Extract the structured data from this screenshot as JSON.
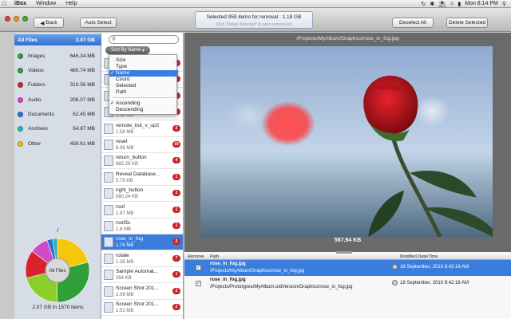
{
  "menubar": {
    "app_name": "iBox",
    "menus": [
      "Window",
      "Help"
    ],
    "clock": "Mon 8:14 PM",
    "icons": [
      "apple-icon",
      "sync-icon",
      "bluetooth-icon",
      "wifi-icon",
      "volume-icon",
      "battery-icon",
      "spotlight-icon"
    ]
  },
  "toolbar": {
    "back_label": "Back",
    "auto_select_label": "Auto Select",
    "status_line1": "Selected 959 items for removal : 1.18 GB",
    "status_line2": "Click \"Delete Selected\" to open remove list",
    "deselect_all_label": "Deselect All",
    "delete_selected_label": "Delete Selected"
  },
  "sidebar": {
    "categories": [
      {
        "name": "All Files",
        "size": "2.07 GB",
        "color": "#3b7ddd"
      },
      {
        "name": "Images",
        "size": "646.34 MB",
        "color": "#2f9f3a"
      },
      {
        "name": "Videos",
        "size": "460.74 MB",
        "color": "#2f9f3a"
      },
      {
        "name": "Folders",
        "size": "310.56 MB",
        "color": "#d02a2a"
      },
      {
        "name": "Audio",
        "size": "206.07 MB",
        "color": "#d24ac8"
      },
      {
        "name": "Documents",
        "size": "62.45 MB",
        "color": "#2d6fd1"
      },
      {
        "name": "Archives",
        "size": "54.87 MB",
        "color": "#2fb3b3"
      },
      {
        "name": "Other",
        "size": "458.61 MB",
        "color": "#e0c020"
      }
    ],
    "pie_caption": "/",
    "pie_center_label": "All Files",
    "footer": "2.07 GB in 1570 items",
    "pie_slices": [
      {
        "label": "Other",
        "value": 458.61,
        "color": "#f5c60a"
      },
      {
        "label": "Images",
        "value": 646.34,
        "color": "#2f9f3a"
      },
      {
        "label": "Videos",
        "value": 460.74,
        "color": "#8ccf2a"
      },
      {
        "label": "Folders",
        "value": 310.56,
        "color": "#d8232a"
      },
      {
        "label": "Audio",
        "value": 206.07,
        "color": "#d24ac8"
      },
      {
        "label": "Documents",
        "value": 62.45,
        "color": "#2d6fd1"
      },
      {
        "label": "Archives",
        "value": 54.87,
        "color": "#2fb3b3"
      }
    ]
  },
  "filelist": {
    "sort_label": "Sort By Name",
    "sort_menu": [
      {
        "label": "Size",
        "checked": false,
        "highlighted": false
      },
      {
        "label": "Type",
        "checked": false,
        "highlighted": false
      },
      {
        "label": "Name",
        "checked": true,
        "highlighted": true
      },
      {
        "label": "Count",
        "checked": false,
        "highlighted": false
      },
      {
        "label": "Selected",
        "checked": false,
        "highlighted": false
      },
      {
        "label": "Path",
        "checked": false,
        "highlighted": false
      },
      {
        "label": "Ascending",
        "checked": true,
        "highlighted": false
      },
      {
        "label": "Descending",
        "checked": false,
        "highlighted": false
      }
    ],
    "items": [
      {
        "name": "",
        "size": "",
        "badge": "1"
      },
      {
        "name": "",
        "size": "",
        "badge": "2"
      },
      {
        "name": "",
        "size": "",
        "badge": "1"
      },
      {
        "name": "",
        "size": "1.58 MB",
        "badge": "2"
      },
      {
        "name": "remote_but_v_up2",
        "size": "1.58 MB",
        "badge": "2"
      },
      {
        "name": "reset",
        "size": "8.96 MB",
        "badge": "19"
      },
      {
        "name": "return_button",
        "size": "682.28 KB",
        "badge": "4"
      },
      {
        "name": "Reveal Database...",
        "size": "5.75 KB",
        "badge": "1"
      },
      {
        "name": "right_button",
        "size": "680.24 KB",
        "badge": "2"
      },
      {
        "name": "roof",
        "size": "1.97 MB",
        "badge": "1"
      },
      {
        "name": "roof3s",
        "size": "1.8 MB",
        "badge": "1"
      },
      {
        "name": "rose_in_fog",
        "size": "1.76 MB",
        "badge": "2"
      },
      {
        "name": "rotate",
        "size": "1.35 MB",
        "badge": "7"
      },
      {
        "name": "Sample Automat...",
        "size": "354 KB",
        "badge": "1"
      },
      {
        "name": "Screen Shot 201...",
        "size": "2.09 MB",
        "badge": "2"
      },
      {
        "name": "Screen Shot 201...",
        "size": "1.51 MB",
        "badge": "2"
      }
    ]
  },
  "preview": {
    "title": "/Projects/MyAlbum/Graphics/rose_in_fog.jpg",
    "size": "587.94 KB"
  },
  "table": {
    "headers": [
      "Remove",
      "Path",
      "Modified Date/Time"
    ],
    "rows": [
      {
        "name": "rose_in_fog.jpg",
        "path": "/Projects/MyAlbum/Graphics/rose_in_fog.jpg",
        "date": "18 September, 2010 8:42:16 AM",
        "checked": true
      },
      {
        "name": "rose_in_fog.jpg",
        "path": "/Projects/Prototypes/MyAlbum.oldVersion/Graphics/rose_in_fog.jpg",
        "date": "18 September, 2010 8:42:16 AM",
        "checked": true
      }
    ]
  },
  "colors": {
    "selection": "#3b7ddd",
    "badge": "#c8242a",
    "sidebar_bg": "#d6dde6",
    "preview_bg": "#6a6a6a"
  }
}
